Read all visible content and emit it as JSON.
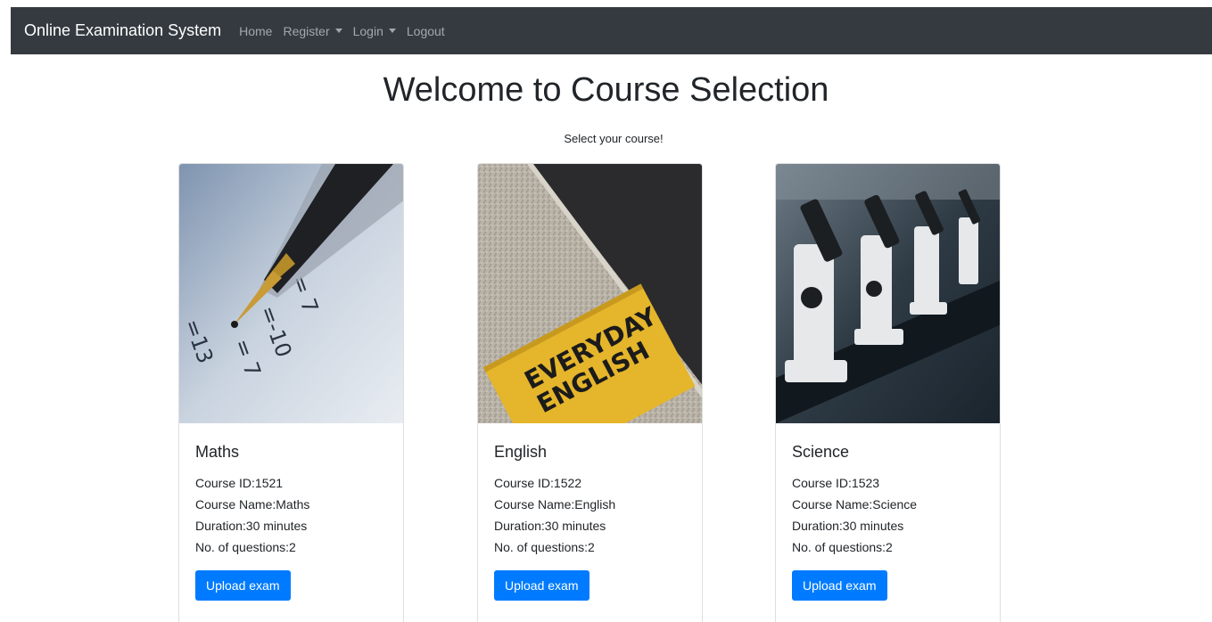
{
  "navbar": {
    "brand": "Online Examination System",
    "items": [
      {
        "label": "Home",
        "dropdown": false
      },
      {
        "label": "Register",
        "dropdown": true
      },
      {
        "label": "Login",
        "dropdown": true
      },
      {
        "label": "Logout",
        "dropdown": false
      }
    ]
  },
  "header": {
    "title": "Welcome to Course Selection",
    "subtitle": "Select your course!"
  },
  "courses": [
    {
      "name": "Maths",
      "id_line": "Course ID:1521",
      "name_line": "Course Name:Maths",
      "duration_line": "Duration:30 minutes",
      "questions_line": "No. of questions:2",
      "button": "Upload exam",
      "image_text": [
        "= 7",
        "=-10",
        "= 7",
        "=13"
      ]
    },
    {
      "name": "English",
      "id_line": "Course ID:1522",
      "name_line": "Course Name:English",
      "duration_line": "Duration:30 minutes",
      "questions_line": "No. of questions:2",
      "button": "Upload exam",
      "image_text": [
        "EVERYDAY",
        "ENGLISH"
      ]
    },
    {
      "name": "Science",
      "id_line": "Course ID:1523",
      "name_line": "Course Name:Science",
      "duration_line": "Duration:30 minutes",
      "questions_line": "No. of questions:2",
      "button": "Upload exam",
      "image_text": []
    }
  ],
  "colors": {
    "navbar_bg": "#343a40",
    "button_bg": "#007bff"
  }
}
